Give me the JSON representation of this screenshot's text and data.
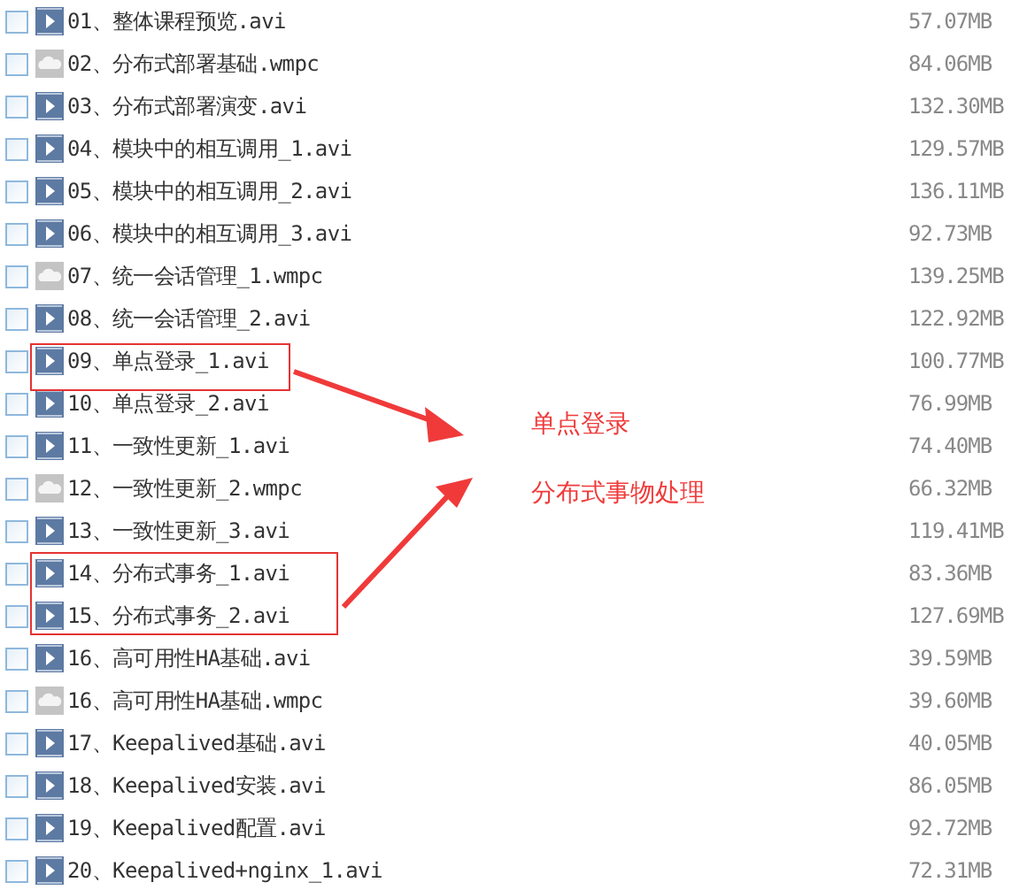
{
  "files": [
    {
      "kind": "video",
      "name": "01、整体课程预览.avi",
      "size": "57.07MB",
      "checked": false
    },
    {
      "kind": "cloud",
      "name": "02、分布式部署基础.wmpc",
      "size": "84.06MB",
      "checked": false
    },
    {
      "kind": "video",
      "name": "03、分布式部署演变.avi",
      "size": "132.30MB",
      "checked": false
    },
    {
      "kind": "video",
      "name": "04、模块中的相互调用_1.avi",
      "size": "129.57MB",
      "checked": false
    },
    {
      "kind": "video",
      "name": "05、模块中的相互调用_2.avi",
      "size": "136.11MB",
      "checked": false
    },
    {
      "kind": "video",
      "name": "06、模块中的相互调用_3.avi",
      "size": "92.73MB",
      "checked": false
    },
    {
      "kind": "cloud",
      "name": "07、统一会话管理_1.wmpc",
      "size": "139.25MB",
      "checked": false
    },
    {
      "kind": "video",
      "name": "08、统一会话管理_2.avi",
      "size": "122.92MB",
      "checked": false
    },
    {
      "kind": "video",
      "name": "09、单点登录_1.avi",
      "size": "100.77MB",
      "checked": false
    },
    {
      "kind": "video",
      "name": "10、单点登录_2.avi",
      "size": "76.99MB",
      "checked": false
    },
    {
      "kind": "video",
      "name": "11、一致性更新_1.avi",
      "size": "74.40MB",
      "checked": false
    },
    {
      "kind": "cloud",
      "name": "12、一致性更新_2.wmpc",
      "size": "66.32MB",
      "checked": false
    },
    {
      "kind": "video",
      "name": "13、一致性更新_3.avi",
      "size": "119.41MB",
      "checked": false
    },
    {
      "kind": "video",
      "name": "14、分布式事务_1.avi",
      "size": "83.36MB",
      "checked": false
    },
    {
      "kind": "video",
      "name": "15、分布式事务_2.avi",
      "size": "127.69MB",
      "checked": false
    },
    {
      "kind": "video",
      "name": "16、高可用性HA基础.avi",
      "size": "39.59MB",
      "checked": false
    },
    {
      "kind": "cloud",
      "name": "16、高可用性HA基础.wmpc",
      "size": "39.60MB",
      "checked": false
    },
    {
      "kind": "video",
      "name": "17、Keepalived基础.avi",
      "size": "40.05MB",
      "checked": false
    },
    {
      "kind": "video",
      "name": "18、Keepalived安装.avi",
      "size": "86.05MB",
      "checked": false
    },
    {
      "kind": "video",
      "name": "19、Keepalived配置.avi",
      "size": "92.72MB",
      "checked": false
    },
    {
      "kind": "video",
      "name": "20、Keepalived+nginx_1.avi",
      "size": "72.31MB",
      "checked": false
    }
  ],
  "notes": [
    "单点登录",
    "分布式事物处理"
  ]
}
